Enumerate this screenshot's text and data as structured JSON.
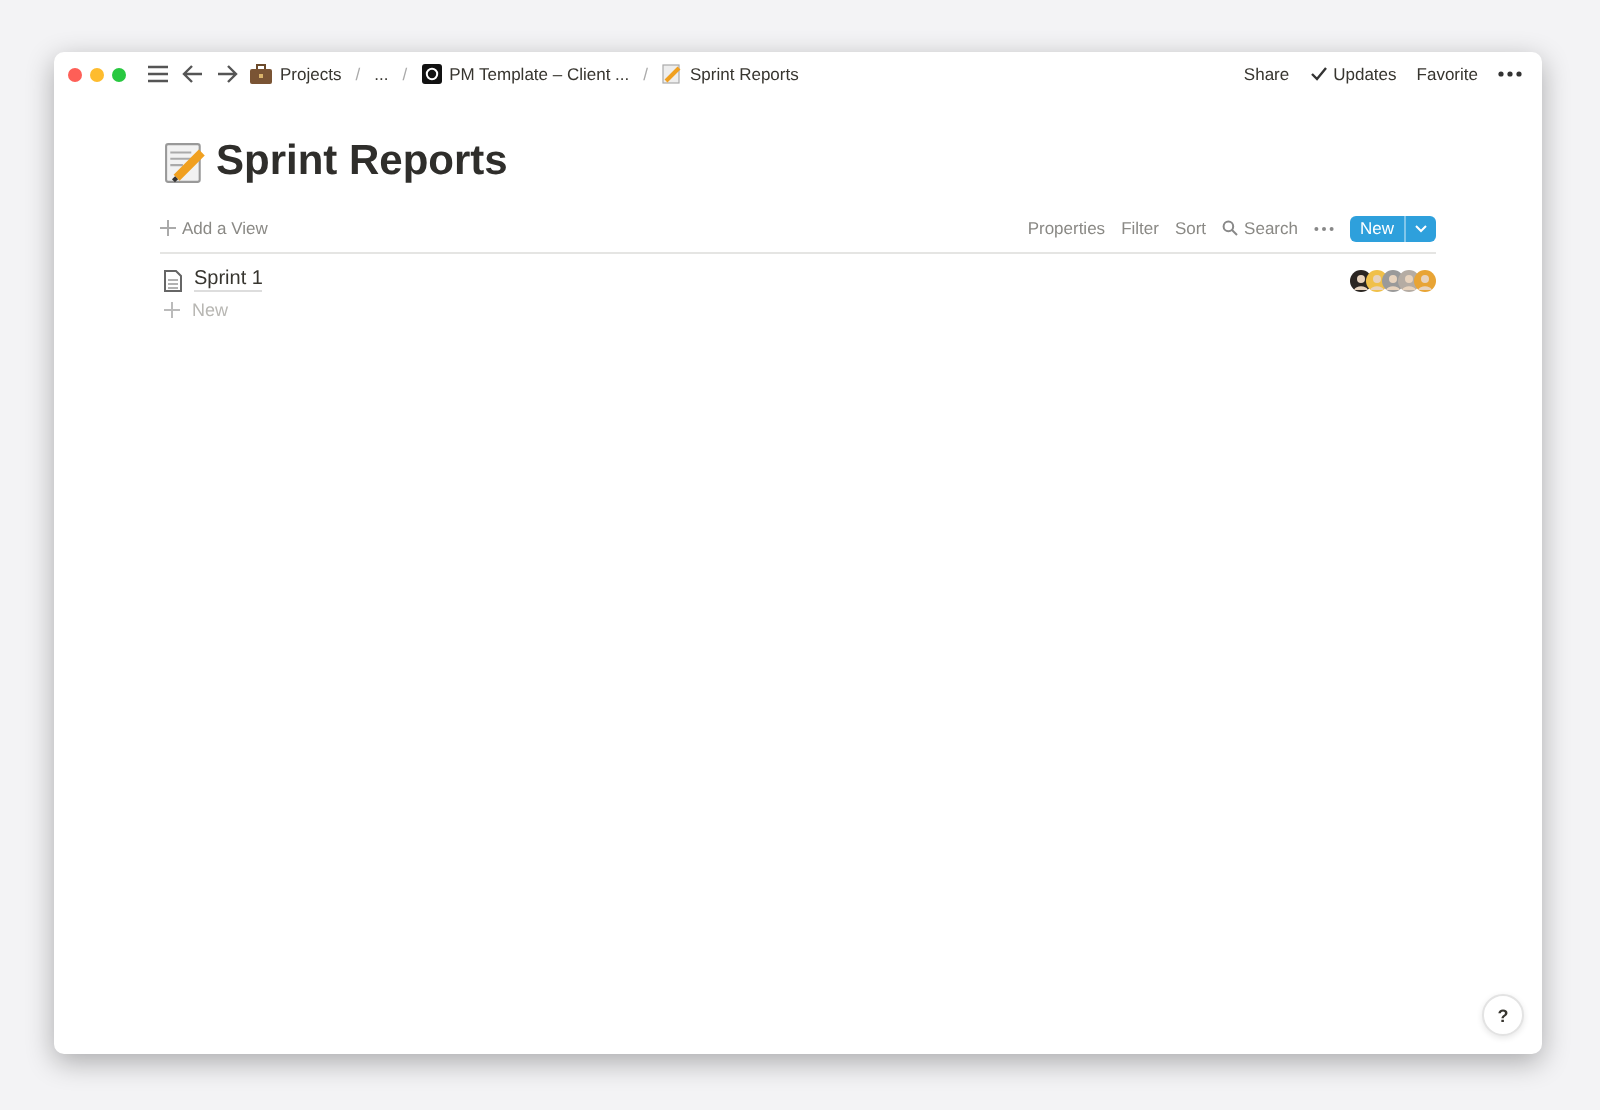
{
  "window": {
    "breadcrumbs": [
      {
        "label": "Projects",
        "kind": "project"
      },
      {
        "label": "/",
        "kind": "separator"
      },
      {
        "label": "...",
        "kind": "plain"
      },
      {
        "label": "/",
        "kind": "separator"
      },
      {
        "label": "PM Template – Client ...",
        "kind": "workspace"
      },
      {
        "label": "/",
        "kind": "separator"
      },
      {
        "label": "Sprint Reports",
        "kind": "page"
      }
    ],
    "actions": [
      {
        "label": "Share",
        "kind": "text"
      },
      {
        "label": "Updates",
        "kind": "check"
      },
      {
        "label": "Favorite",
        "kind": "text"
      }
    ]
  },
  "page": {
    "title": "Sprint Reports",
    "add_view": "Add a View",
    "toolbar": [
      {
        "label": "Properties",
        "kind": "text"
      },
      {
        "label": "Filter",
        "kind": "text"
      },
      {
        "label": "Sort",
        "kind": "text"
      },
      {
        "label": "Search",
        "kind": "search"
      }
    ],
    "new_button": "New",
    "rows": [
      {
        "title": "Sprint 1",
        "people": [
          {
            "color": "#2b2622"
          },
          {
            "color": "#f0c04a"
          },
          {
            "color": "#9a9a9a"
          },
          {
            "color": "#b5aca3"
          },
          {
            "color": "#e8a435"
          }
        ]
      }
    ],
    "new_row": "New"
  },
  "help": "?"
}
